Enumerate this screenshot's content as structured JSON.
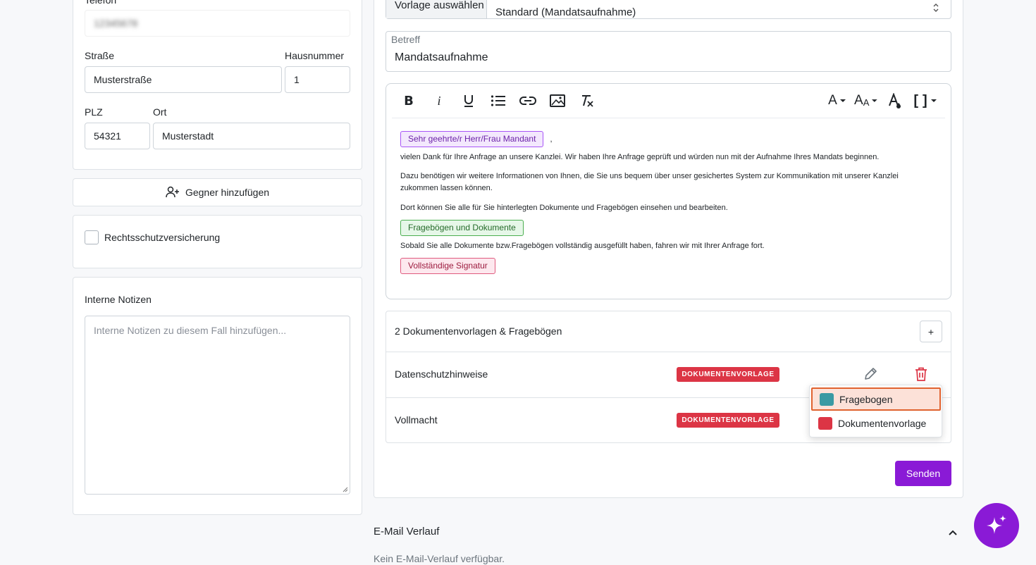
{
  "left": {
    "telefon_label": "Telefon",
    "telefon_value": "12345678",
    "strasse_label": "Straße",
    "strasse_value": "Musterstraße",
    "hausnummer_label": "Hausnummer",
    "hausnummer_value": "1",
    "plz_label": "PLZ",
    "plz_value": "54321",
    "ort_label": "Ort",
    "ort_value": "Musterstadt",
    "add_opponent_label": "Gegner hinzufügen",
    "rechtsschutz_label": "Rechtsschutzversicherung",
    "notes_label": "Interne Notizen",
    "notes_placeholder": "Interne Notizen zu diesem Fall hinzufügen..."
  },
  "email": {
    "template_label": "Vorlage auswählen",
    "template_value": "Standard (Mandatsaufnahme)",
    "subject_label": "Betreff",
    "subject_value": "Mandatsaufnahme",
    "toolbar_icons": [
      "bold-icon",
      "italic-icon",
      "underline-icon",
      "bulleted-list-icon",
      "link-icon",
      "image-icon",
      "clear-format-icon",
      "font-color-icon",
      "font-size-icon",
      "highlight-icon",
      "placeholder-icon"
    ],
    "body": {
      "greeting_tag": "Sehr geehrte/r Herr/Frau Mandant",
      "greeting_comma": ",",
      "para1": "vielen Dank für Ihre Anfrage an unsere Kanzlei. Wir haben Ihre Anfrage geprüft und würden nun mit der Aufnahme Ihres Mandats beginnen.",
      "para2": "Dazu benötigen wir weitere Informationen von Ihnen, die Sie uns bequem über unser gesichertes System zur Kommunikation mit unserer Kanzlei zukommen lassen können.",
      "para3": "Dort können Sie alle für Sie hinterlegten Dokumente und Fragebögen einsehen und bearbeiten.",
      "docs_tag": "Fragebögen und Dokumente",
      "para4": "Sobald Sie alle Dokumente bzw.Fragebögen vollständig ausgefüllt haben, fahren wir mit Ihrer Anfrage fort.",
      "signature_tag": "Vollständige Signatur"
    },
    "docs_header": "2 Dokumentenvorlagen & Fragebögen",
    "add_doc_label": "+",
    "docs": [
      {
        "name": "Datenschutzhinweise",
        "type": "DOKUMENTENVORLAGE"
      },
      {
        "name": "Vollmacht",
        "type": "DOKUMENTENVORLAGE"
      }
    ],
    "dropdown_options": [
      {
        "label": "Fragebogen",
        "color": "#3a9aa3"
      },
      {
        "label": "Dokumentenvorlage",
        "color": "#dc3545"
      }
    ],
    "send_label": "Senden"
  },
  "history": {
    "title": "E-Mail Verlauf",
    "empty_text": "Kein E-Mail-Verlauf verfügbar."
  },
  "colors": {
    "accent": "#8a1ad6",
    "danger": "#dc3545",
    "teal": "#3a9aa3"
  }
}
